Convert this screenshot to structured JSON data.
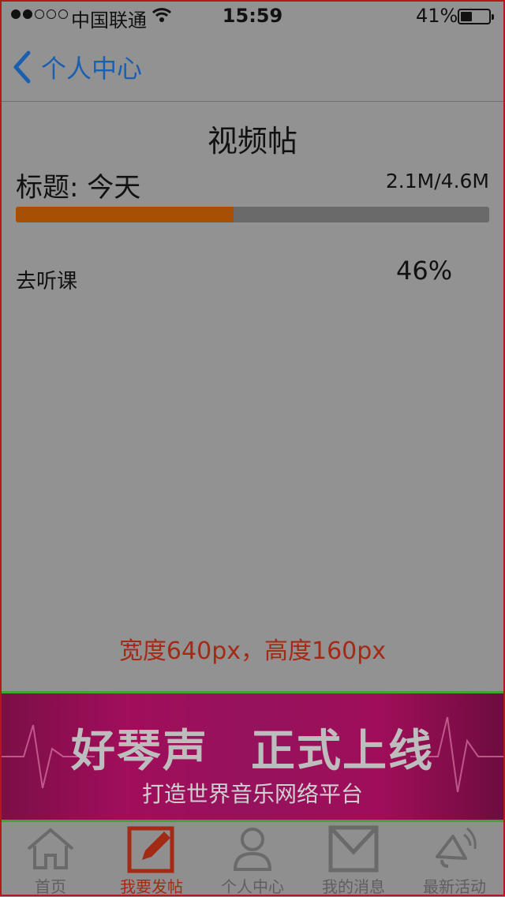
{
  "status_bar": {
    "carrier": "中国联通",
    "time": "15:59",
    "battery": "41%",
    "battery_level": 0.41
  },
  "nav": {
    "back_label": "个人中心"
  },
  "page": {
    "title": "视频帖",
    "post_title": "标题:  今天",
    "size_progress": "2.1M/4.6M",
    "progress_fraction": 0.46,
    "task_label": "去听课",
    "percent": "46%",
    "dimension_note": "宽度640px，高度160px"
  },
  "banner": {
    "title_left": "好琴声",
    "title_right": "正式上线",
    "subtitle": "打造世界音乐网络平台"
  },
  "tabbar": {
    "items": [
      {
        "label": "首页",
        "icon": "home-icon"
      },
      {
        "label": "我要发帖",
        "icon": "compose-icon",
        "active": true
      },
      {
        "label": "个人中心",
        "icon": "user-icon"
      },
      {
        "label": "我的消息",
        "icon": "mail-icon"
      },
      {
        "label": "最新活动",
        "icon": "megaphone-icon"
      }
    ]
  },
  "colors": {
    "accent": "#1b5fb0",
    "progress": "#a75005",
    "active_tab": "#a32a14",
    "banner": "#a10e5b"
  }
}
